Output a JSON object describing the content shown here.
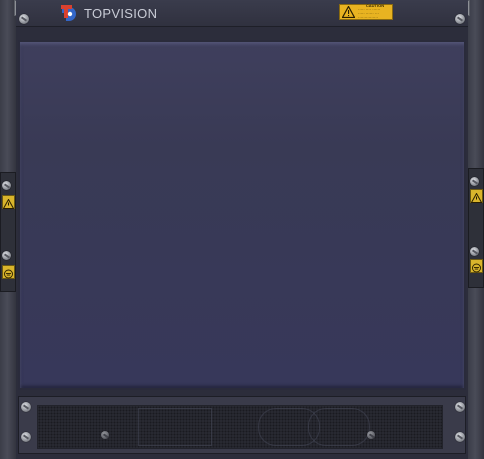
{
  "header": {
    "logo_text": "TOPVISION",
    "caution_label": {
      "title": "CAUTION",
      "line1": "·····  ····  ······",
      "line2": "·····  ······  ···",
      "line3": "···············"
    }
  },
  "colors": {
    "chassis": "#2c2d3b",
    "slot_area": "#3a3b58",
    "caution_yellow": "#e8b321",
    "logo_red": "#d9412f",
    "logo_blue": "#3366c8"
  },
  "icons": {
    "logo": "topvision-logo-icon",
    "caution": "warning-triangle-icon",
    "esd": "esd-warning-icon",
    "ground": "ground-symbol-icon",
    "screw": "screw-icon"
  }
}
